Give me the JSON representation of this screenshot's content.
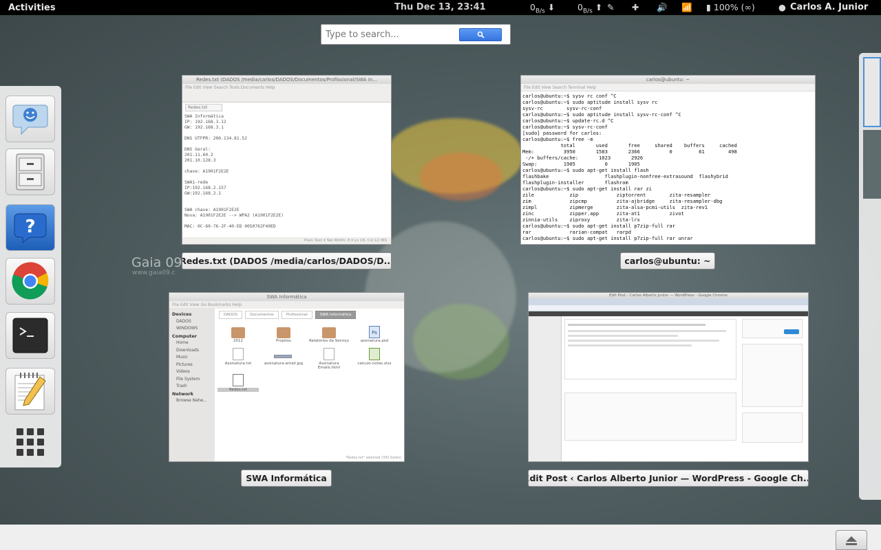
{
  "topbar": {
    "activities": "Activities",
    "clock": "Thu Dec 13, 23:41",
    "net_down": "0",
    "net_down_unit": "B/s",
    "net_up": "0",
    "net_up_unit": "B/s",
    "battery": "100% (∞)",
    "user": "Carlos A. Junior"
  },
  "search": {
    "placeholder": "Type to search..."
  },
  "wallpaper": {
    "brand": "Gaia 09",
    "url": "www.gaia09.c"
  },
  "dash": {
    "items": [
      "empathy-icon",
      "file-cabinet-icon",
      "help-icon",
      "chrome-icon",
      "terminal-icon",
      "text-editor-icon",
      "show-apps-icon"
    ]
  },
  "windows": {
    "gedit": {
      "title": "Redes.txt (DADOS /media/carlos/DADOS/Documentos/Profissional/SWA In...",
      "menu": "File   Edit   View   Search   Tools   Documents   Help",
      "tab": "Redes.txt",
      "text": "SWA Informática\nIP: 192.168.3.12\nGW: 192.168.3.1\n\nDNS UTFPR: 200.134.81.52\n\nDNS Geral:\n201.11.60.2\n201.10.128.3\n\nchave: A1901F2E2E\n\nSWA1-rede\nIP:192.168.2.157\nGW:192.168.2.1\n\n\nSWA chave: A1901F2E2E\nNova: A1901F2E2E --> WPA2 (A1901F2E2E)\n\nMAC: 0C-60-76-2F-40-ED 0050762F40ED",
      "status": "Plain Text ▾     Tab Width: 8 ▾     Ln 18, Col 12     INS",
      "caption": "Redes.txt (DADOS /media/carlos/DADOS/D..."
    },
    "terminal": {
      "title": "carlos@ubuntu: ~",
      "menu": "File   Edit   View   Search   Terminal   Help",
      "text": "carlos@ubuntu:~$ sysv rc conf ^C\ncarlos@ubuntu:~$ sudo aptitude install sysv rc\nsysv-rc        sysv-rc-conf\ncarlos@ubuntu:~$ sudo aptitude install sysv-rc-conf ^C\ncarlos@ubuntu:~$ update-rc.d ^C\ncarlos@ubuntu:~$ sysv-rc-conf\n[sudo] password for carlos:\ncarlos@ubuntu:~$ free -m\n             total       used       free     shared    buffers     cached\nMem:          3950       1583       2366          0         61        498\n -/+ buffers/cache:       1023       2926\nSwap:         1905          0       1905\ncarlos@ubuntu:~$ sudo apt-get install flash\nflashbake                   flashplugin-nonfree-extrasound  flashybrid\nflashplugin-installer       flashrom\ncarlos@ubuntu:~$ sudo apt-get install rar zi\nzile            zip             ziptorrent        zita-resampler\nzim             zipcmp          zita-ajbridge     zita-resampler-dbg\nzimpl           zipmerge        zita-alsa-pcmi-utils  zita-rev1\nzinc            zipper.app      zita-at1          zivot\nzinnia-utils    ziproxy         zita-lrx\ncarlos@ubuntu:~$ sudo apt-get install p7zip-full rar\nrar             rarian-compat   rarpd\ncarlos@ubuntu:~$ sudo apt-get install p7zip-full rar unrar",
      "caption": "carlos@ubuntu: ~"
    },
    "nautilus": {
      "title": "SWA Informática",
      "menu": "File   Edit   View   Go   Bookmarks   Help",
      "path": [
        "DADOS",
        "Documentos",
        "Profissional",
        "SWA Informática"
      ],
      "sidebar_devices": "Devices",
      "devices": [
        "DADOS",
        "WINDOWS"
      ],
      "sidebar_computer": "Computer",
      "computer": [
        "Home",
        "Downloads",
        "Music",
        "Pictures",
        "Videos",
        "File System",
        "Trash"
      ],
      "sidebar_network": "Network",
      "network": [
        "Browse Netw..."
      ],
      "files": [
        "2012",
        "Projetos",
        "Relatórios de Serviço",
        "assinatura.psd",
        "Assinatura.txt",
        "assinatura-email.jpg",
        "Assinatura Emails.html",
        "calculo-notas.xlsx",
        "Redes.txt"
      ],
      "status": "\"Redes.txt\" selected (392 bytes)",
      "caption": "SWA Informática"
    },
    "chrome": {
      "title": "Edit Post ‹ Carlos Alberto Junior — WordPress - Google Chrome",
      "caption": "Edit Post ‹ Carlos Alberto Junior — WordPress - Google Ch..."
    }
  }
}
